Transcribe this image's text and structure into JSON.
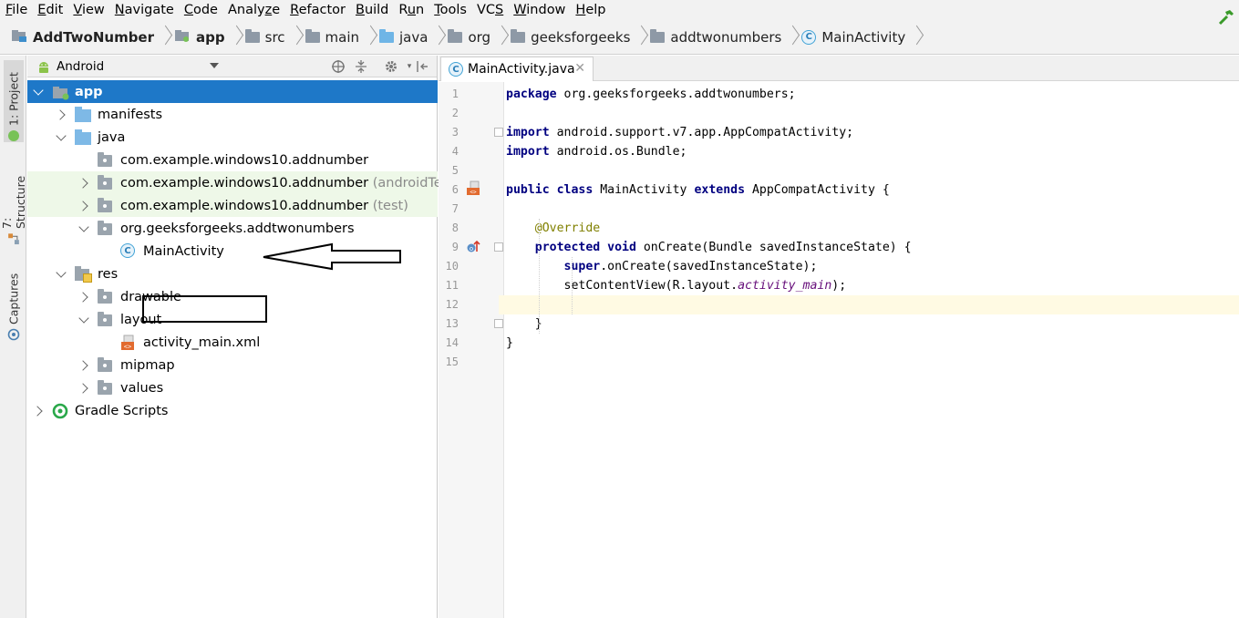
{
  "menu": [
    {
      "mnemonic": "F",
      "rest": "ile"
    },
    {
      "mnemonic": "E",
      "rest": "dit"
    },
    {
      "mnemonic": "V",
      "rest": "iew"
    },
    {
      "mnemonic": "N",
      "rest": "avigate"
    },
    {
      "mnemonic": "C",
      "rest": "ode"
    },
    {
      "pre": "Analy",
      "mnemonic": "z",
      "rest": "e"
    },
    {
      "mnemonic": "R",
      "rest": "efactor"
    },
    {
      "mnemonic": "B",
      "rest": "uild"
    },
    {
      "pre": "R",
      "mnemonic": "u",
      "rest": "n"
    },
    {
      "mnemonic": "T",
      "rest": "ools"
    },
    {
      "pre": "VC",
      "mnemonic": "S",
      "rest": ""
    },
    {
      "mnemonic": "W",
      "rest": "indow"
    },
    {
      "mnemonic": "H",
      "rest": "elp"
    }
  ],
  "breadcrumb": [
    "AddTwoNumber",
    "app",
    "src",
    "main",
    "java",
    "org",
    "geeksforgeeks",
    "addtwonumbers",
    "MainActivity"
  ],
  "side_tabs": {
    "project": "1: Project",
    "structure": "7: Structure",
    "captures": "Captures"
  },
  "project_view": {
    "selector": "Android"
  },
  "tree": [
    {
      "label": "app",
      "suffix": ""
    },
    {
      "label": "manifests",
      "suffix": ""
    },
    {
      "label": "java",
      "suffix": ""
    },
    {
      "label": "com.example.windows10.addnumber",
      "suffix": ""
    },
    {
      "label": "com.example.windows10.addnumber",
      "suffix": " (androidTest)"
    },
    {
      "label": "com.example.windows10.addnumber",
      "suffix": " (test)"
    },
    {
      "label": "org.geeksforgeeks.addtwonumbers",
      "suffix": ""
    },
    {
      "label": "MainActivity",
      "suffix": ""
    },
    {
      "label": "res",
      "suffix": ""
    },
    {
      "label": "drawable",
      "suffix": ""
    },
    {
      "label": "layout",
      "suffix": ""
    },
    {
      "label": "activity_main.xml",
      "suffix": ""
    },
    {
      "label": "mipmap",
      "suffix": ""
    },
    {
      "label": "values",
      "suffix": ""
    },
    {
      "label": "Gradle Scripts",
      "suffix": ""
    }
  ],
  "editor": {
    "tab_title": "MainActivity.java",
    "tab_close": "✕",
    "current_line": 12,
    "lines": [
      {
        "n": "1",
        "tokens": [
          {
            "t": "package",
            "k": "kw"
          },
          {
            "t": " org.geeksforgeeks.addtwonumbers;",
            "k": ""
          }
        ]
      },
      {
        "n": "2",
        "tokens": []
      },
      {
        "n": "3",
        "tokens": [
          {
            "t": "import",
            "k": "kw"
          },
          {
            "t": " android.support.v7.app.AppCompatActivity;",
            "k": ""
          }
        ]
      },
      {
        "n": "4",
        "tokens": [
          {
            "t": "import",
            "k": "kw"
          },
          {
            "t": " android.os.Bundle;",
            "k": ""
          }
        ]
      },
      {
        "n": "5",
        "tokens": []
      },
      {
        "n": "6",
        "tokens": [
          {
            "t": "public class",
            "k": "kw"
          },
          {
            "t": " MainActivity ",
            "k": ""
          },
          {
            "t": "extends",
            "k": "kw"
          },
          {
            "t": " AppCompatActivity {",
            "k": ""
          }
        ]
      },
      {
        "n": "7",
        "tokens": []
      },
      {
        "n": "8",
        "tokens": [
          {
            "t": "    ",
            "k": ""
          },
          {
            "t": "@Override",
            "k": "ann"
          }
        ]
      },
      {
        "n": "9",
        "tokens": [
          {
            "t": "    ",
            "k": ""
          },
          {
            "t": "protected void",
            "k": "kw"
          },
          {
            "t": " onCreate(Bundle savedInstanceState) {",
            "k": ""
          }
        ]
      },
      {
        "n": "10",
        "tokens": [
          {
            "t": "        ",
            "k": ""
          },
          {
            "t": "super",
            "k": "kw"
          },
          {
            "t": ".onCreate(savedInstanceState);",
            "k": ""
          }
        ]
      },
      {
        "n": "11",
        "tokens": [
          {
            "t": "        setContentView(R.layout.",
            "k": ""
          },
          {
            "t": "activity_main",
            "k": "fld"
          },
          {
            "t": ");",
            "k": ""
          }
        ]
      },
      {
        "n": "12",
        "tokens": []
      },
      {
        "n": "13",
        "tokens": [
          {
            "t": "    }",
            "k": ""
          }
        ]
      },
      {
        "n": "14",
        "tokens": [
          {
            "t": "}",
            "k": ""
          }
        ]
      },
      {
        "n": "15",
        "tokens": []
      }
    ]
  },
  "colors": {
    "selection": "#1e78c8",
    "test_row_bg": "#eef8e8",
    "keyword": "#000080",
    "annotation": "#808000",
    "field": "#660e7a",
    "current_line": "#fffae3"
  }
}
